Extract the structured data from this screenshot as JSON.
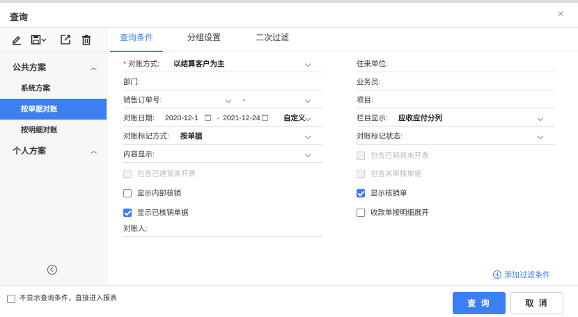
{
  "window": {
    "title": "查询",
    "close_label": "×"
  },
  "toolbar": {
    "icons": [
      "edit-icon",
      "save-icon",
      "export-icon",
      "delete-icon"
    ]
  },
  "sidebar": {
    "groups": [
      {
        "label": "公共方案",
        "items": [
          "系统方案",
          "按单据对账",
          "按明细对账"
        ],
        "active_item": "按单据对账"
      },
      {
        "label": "个人方案",
        "items": []
      }
    ]
  },
  "tabs": [
    "查询条件",
    "分组设置",
    "二次过滤"
  ],
  "form": {
    "left": {
      "recon_method": {
        "label": "对账方式:",
        "value": "以结算客户为主",
        "required": "*"
      },
      "department": {
        "label": "部门:"
      },
      "sales_order": {
        "label": "销售订单号:",
        "value": "-"
      },
      "recon_date": {
        "label": "对账日期:",
        "from": "2020-12-1",
        "sep": "-",
        "to": "2021-12-24",
        "range_type": "自定义"
      },
      "recon_mark_method": {
        "label": "对账标记方式:",
        "value": "按单据"
      },
      "content_display": {
        "label": "内容显示:"
      },
      "include_purchase_uninvoiced": {
        "label": "包含已进货未开票",
        "checked": false,
        "disabled": true
      },
      "show_internal_writeoff": {
        "label": "显示内部核销",
        "checked": false,
        "disabled": false
      },
      "show_written_off_docs": {
        "label": "显示已核销单据",
        "checked": true,
        "disabled": false
      },
      "reconciler": {
        "label": "对账人:"
      }
    },
    "right": {
      "counterparty": {
        "label": "往来单位:"
      },
      "salesperson": {
        "label": "业务员:"
      },
      "project": {
        "label": "项目:"
      },
      "column_display": {
        "label": "栏目显示:",
        "value": "应收应付分列"
      },
      "recon_mark_status": {
        "label": "对账标记状态:"
      },
      "include_sold_uninvoiced": {
        "label": "包含已销货未开票",
        "checked": false,
        "disabled": true
      },
      "include_unaudited_docs": {
        "label": "包含未审核单据",
        "checked": false,
        "disabled": true
      },
      "show_writeoff_docs": {
        "label": "显示核销单",
        "checked": true,
        "disabled": false
      },
      "receipt_expand_detail": {
        "label": "收款单按明细展开",
        "checked": false,
        "disabled": false
      }
    }
  },
  "add_filter_label": "添加过滤条件",
  "footer": {
    "skip_query_label": "不显示查询条件，直接进入报表",
    "query_button": "查 询",
    "cancel_button": "取 消"
  },
  "colors": {
    "accent": "#3b7ff0",
    "required": "#e02020"
  }
}
